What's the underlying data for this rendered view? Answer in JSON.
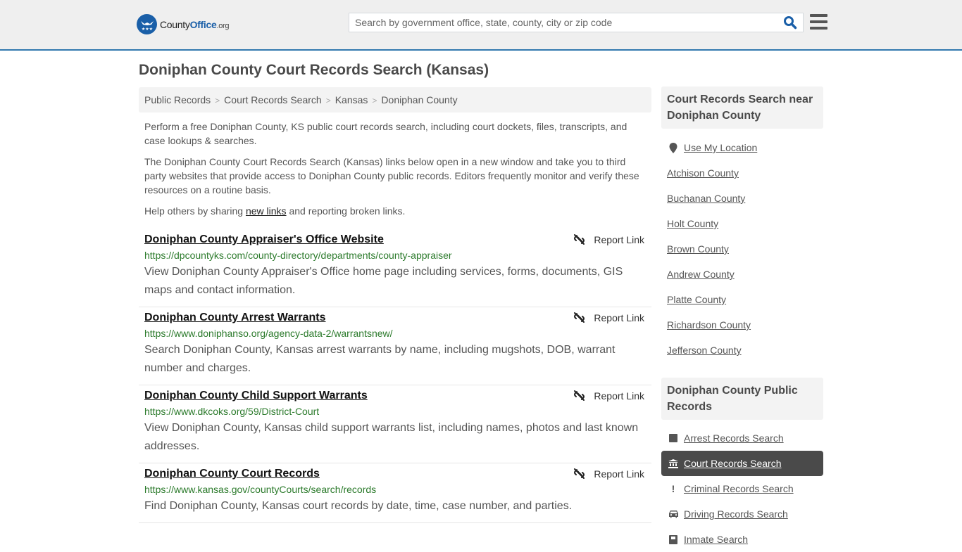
{
  "header": {
    "logo": {
      "county": "County",
      "office": "Office",
      "org": ".org"
    },
    "search": {
      "placeholder": "Search by government office, state, county, city or zip code",
      "value": ""
    },
    "brand_color": "#1a5fa8",
    "accent_border_color": "#3278ae"
  },
  "page": {
    "title": "Doniphan County Court Records Search (Kansas)",
    "breadcrumb": [
      "Public Records",
      "Court Records Search",
      "Kansas",
      "Doniphan County"
    ],
    "intro": {
      "p1": "Perform a free Doniphan County, KS public court records search, including court dockets, files, transcripts, and case lookups & searches.",
      "p2": "The Doniphan County Court Records Search (Kansas) links below open in a new window and take you to third party websites that provide access to Doniphan County public records. Editors frequently monitor and verify these resources on a routine basis.",
      "p3_before": "Help others by sharing ",
      "p3_link": "new links",
      "p3_after": " and reporting broken links."
    }
  },
  "results": [
    {
      "title": "Doniphan County Appraiser's Office Website",
      "url": "https://dpcountyks.com/county-directory/departments/county-appraiser",
      "description": "View Doniphan County Appraiser's Office home page including services, forms, documents, GIS maps and contact information.",
      "report_label": "Report Link"
    },
    {
      "title": "Doniphan County Arrest Warrants",
      "url": "https://www.doniphanso.org/agency-data-2/warrantsnew/",
      "description": "Search Doniphan County, Kansas arrest warrants by name, including mugshots, DOB, warrant number and charges.",
      "report_label": "Report Link"
    },
    {
      "title": "Doniphan County Child Support Warrants",
      "url": "https://www.dkcoks.org/59/District-Court",
      "description": "View Doniphan County, Kansas child support warrants list, including names, photos and last known addresses.",
      "report_label": "Report Link"
    },
    {
      "title": "Doniphan County Court Records",
      "url": "https://www.kansas.gov/countyCourts/search/records",
      "description": "Find Doniphan County, Kansas court records by date, time, case number, and parties.",
      "report_label": "Report Link"
    }
  ],
  "sidebar": {
    "nearby": {
      "heading": "Court Records Search near Doniphan County",
      "use_location": "Use My Location",
      "counties": [
        "Atchison County",
        "Buchanan County",
        "Holt County",
        "Brown County",
        "Andrew County",
        "Platte County",
        "Richardson County",
        "Jefferson County"
      ]
    },
    "public_records": {
      "heading": "Doniphan County Public Records",
      "items": [
        {
          "label": "Arrest Records Search",
          "icon": "square-icon",
          "active": false
        },
        {
          "label": "Court Records Search",
          "icon": "courthouse-icon",
          "active": true
        },
        {
          "label": "Criminal Records Search",
          "icon": "exclamation-icon",
          "active": false
        },
        {
          "label": "Driving Records Search",
          "icon": "car-icon",
          "active": false
        },
        {
          "label": "Inmate Search",
          "icon": "inmate-icon",
          "active": false
        }
      ]
    }
  }
}
